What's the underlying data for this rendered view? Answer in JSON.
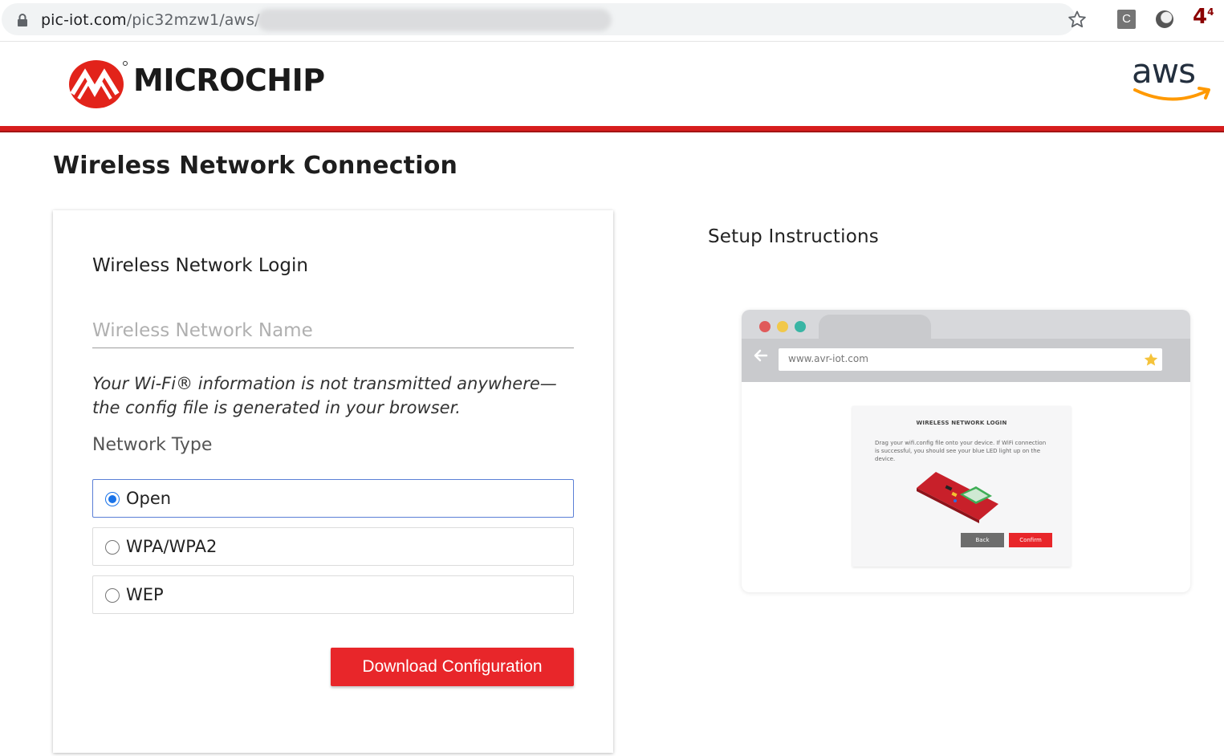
{
  "browser": {
    "url_visible": "pic-iot.com",
    "url_path_visible": "/pic32mzw1/aws/"
  },
  "header": {
    "brand_name": "MICROCHIP",
    "partner_logo_text": "aws",
    "brand_color": "#d71d1d"
  },
  "page": {
    "title": "Wireless Network Connection"
  },
  "login_card": {
    "title": "Wireless Network Login",
    "ssid_placeholder": "Wireless Network Name",
    "ssid_value": "",
    "privacy_note": "Your Wi-Fi® information is not transmitted anywhere—the config file is generated in your browser.",
    "network_type_label": "Network Type",
    "network_types": [
      {
        "label": "Open",
        "selected": true
      },
      {
        "label": "WPA/WPA2",
        "selected": false
      },
      {
        "label": "WEP",
        "selected": false
      }
    ],
    "download_button": "Download Configuration",
    "accent_color": "#e8262a"
  },
  "setup": {
    "title": "Setup Instructions",
    "illustration": {
      "url": "www.avr-iot.com",
      "card_title": "WIRELESS NETWORK LOGIN",
      "card_body": "Drag your wifi.config file onto your device. If WiFi connection is successful, you should see your blue LED light up on the device.",
      "back_label": "Back",
      "confirm_label": "Confirm"
    }
  }
}
